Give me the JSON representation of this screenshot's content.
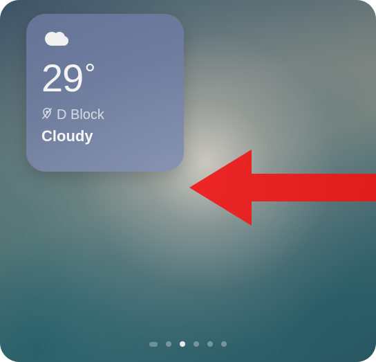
{
  "weather": {
    "temperature": "29",
    "degree_symbol": "°",
    "location": "D Block",
    "condition": "Cloudy"
  },
  "pagination": {
    "total": 6,
    "active_index": 2
  },
  "annotation": {
    "arrow_color": "#ec1b1b"
  }
}
